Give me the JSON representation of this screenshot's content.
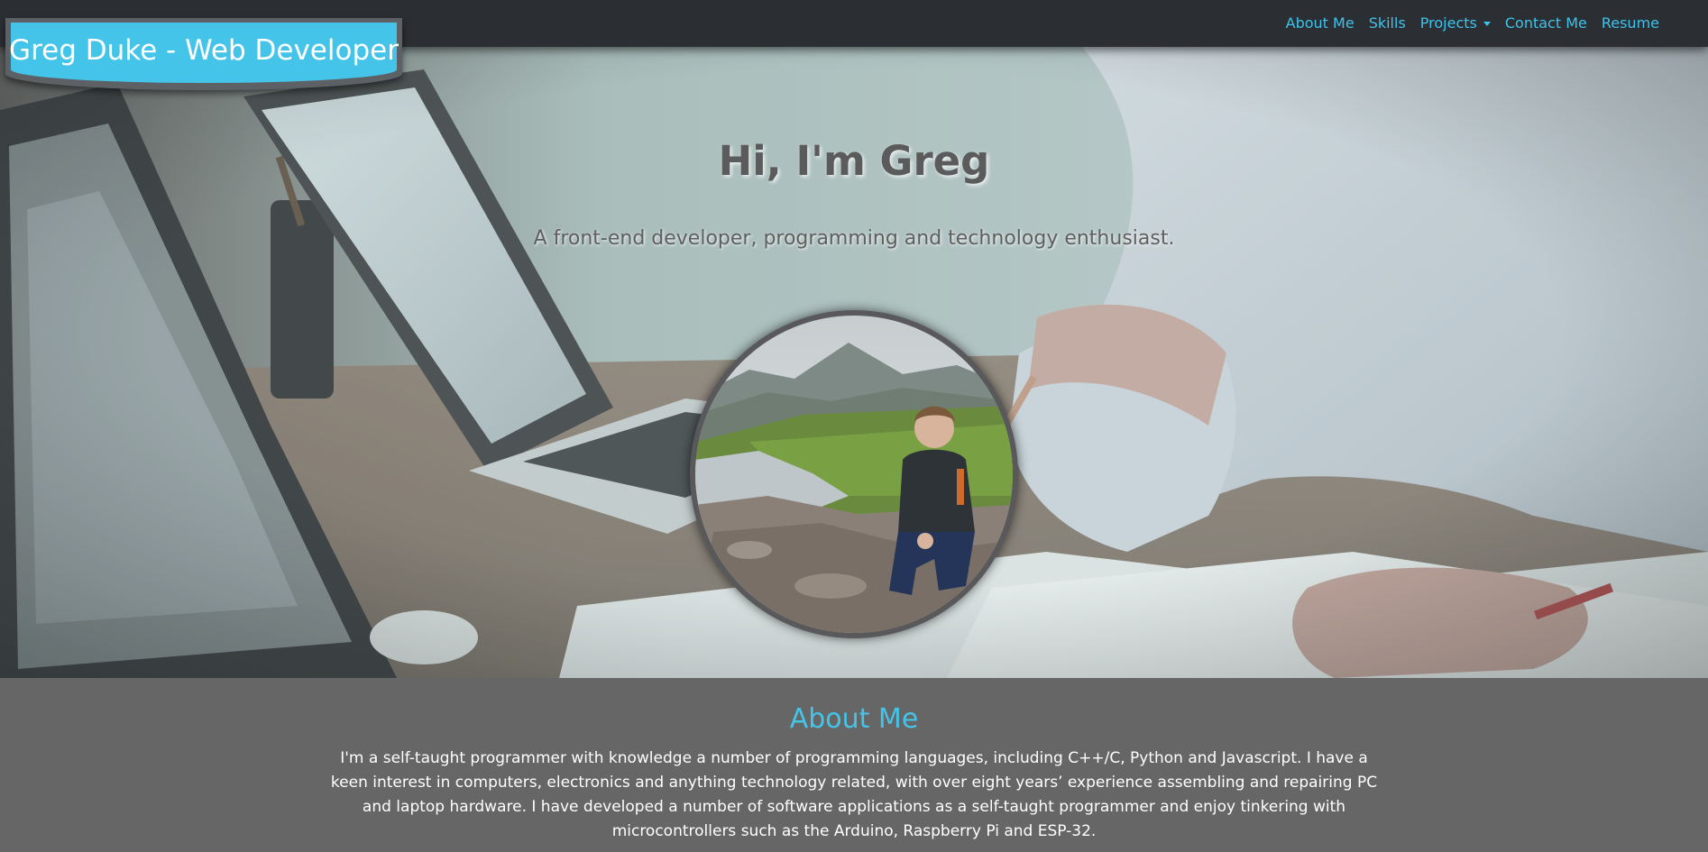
{
  "brand": {
    "title": "Greg Duke - Web Developer"
  },
  "nav": {
    "items": [
      {
        "label": "About Me"
      },
      {
        "label": "Skills"
      },
      {
        "label": "Projects",
        "has_dropdown": true
      },
      {
        "label": "Contact Me"
      },
      {
        "label": "Resume"
      }
    ]
  },
  "hero": {
    "title": "Hi, I'm Greg",
    "subtitle": "A front-end developer, programming and technology enthusiast."
  },
  "about": {
    "title": "About Me",
    "text": "I'm a self-taught programmer with knowledge a number of programming languages, including C++/C, Python and Javascript. I have a keen interest in computers, electronics and anything technology related, with over eight years’ experience assembling and repairing PC and laptop hardware. I have developed a number of software applications as a self-taught programmer and enjoy tinkering with microcontrollers such as the Arduino, Raspberry Pi and ESP-32."
  },
  "colors": {
    "accent": "#45c4e9",
    "nav_link": "#3fc3ea",
    "navbar_bg": "#2b2f33",
    "section_bg": "#666666"
  }
}
